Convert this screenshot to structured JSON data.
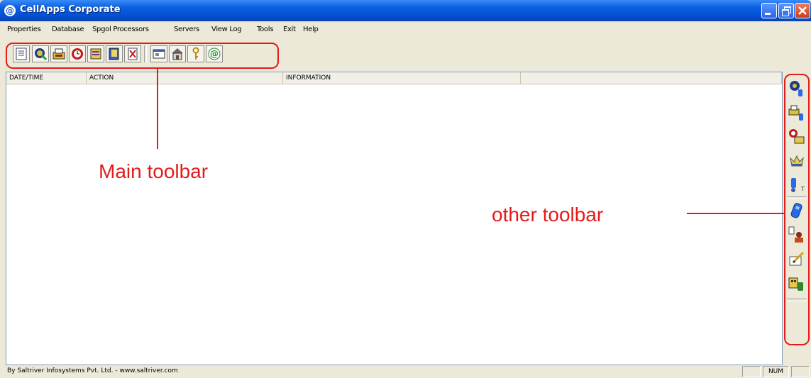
{
  "window": {
    "title": "CellApps Corporate"
  },
  "menu": [
    {
      "label": "Properties"
    },
    {
      "label": "Database"
    },
    {
      "label": "Spgol Processors"
    },
    {
      "label": "Servers"
    },
    {
      "label": "View Log"
    },
    {
      "label": "Tools"
    },
    {
      "label": "Exit"
    },
    {
      "label": "Help"
    }
  ],
  "main_toolbar": {
    "buttons": [
      {
        "icon": "list-icon"
      },
      {
        "icon": "database-connect-icon"
      },
      {
        "icon": "mail-printer-icon"
      },
      {
        "icon": "alarm-clock-icon"
      },
      {
        "icon": "archive-icon"
      },
      {
        "icon": "book-icon"
      },
      {
        "icon": "delete-document-icon"
      },
      {
        "icon": "window-icon"
      },
      {
        "icon": "building-icon"
      },
      {
        "icon": "key-icon"
      },
      {
        "icon": "at-sign-icon"
      }
    ]
  },
  "list": {
    "columns": [
      "DATE/TIME",
      "ACTION",
      "INFORMATION",
      ""
    ]
  },
  "side_toolbar": {
    "buttons": [
      {
        "icon": "db-phone-icon"
      },
      {
        "icon": "printer-phone-icon"
      },
      {
        "icon": "clock-printer-icon"
      },
      {
        "icon": "crown-icon"
      },
      {
        "icon": "phone-text-icon"
      },
      {
        "icon": "mobile-phone-icon"
      },
      {
        "icon": "user-phone-icon"
      },
      {
        "icon": "pencil-note-icon"
      },
      {
        "icon": "building-phone-icon"
      }
    ]
  },
  "status": {
    "text": "By Saltriver Infosystems Pvt. Ltd. - www.saltriver.com",
    "num": "NUM"
  },
  "annotations": {
    "main": "Main toolbar",
    "other": "other toolbar",
    "color": "#e41b1b"
  }
}
